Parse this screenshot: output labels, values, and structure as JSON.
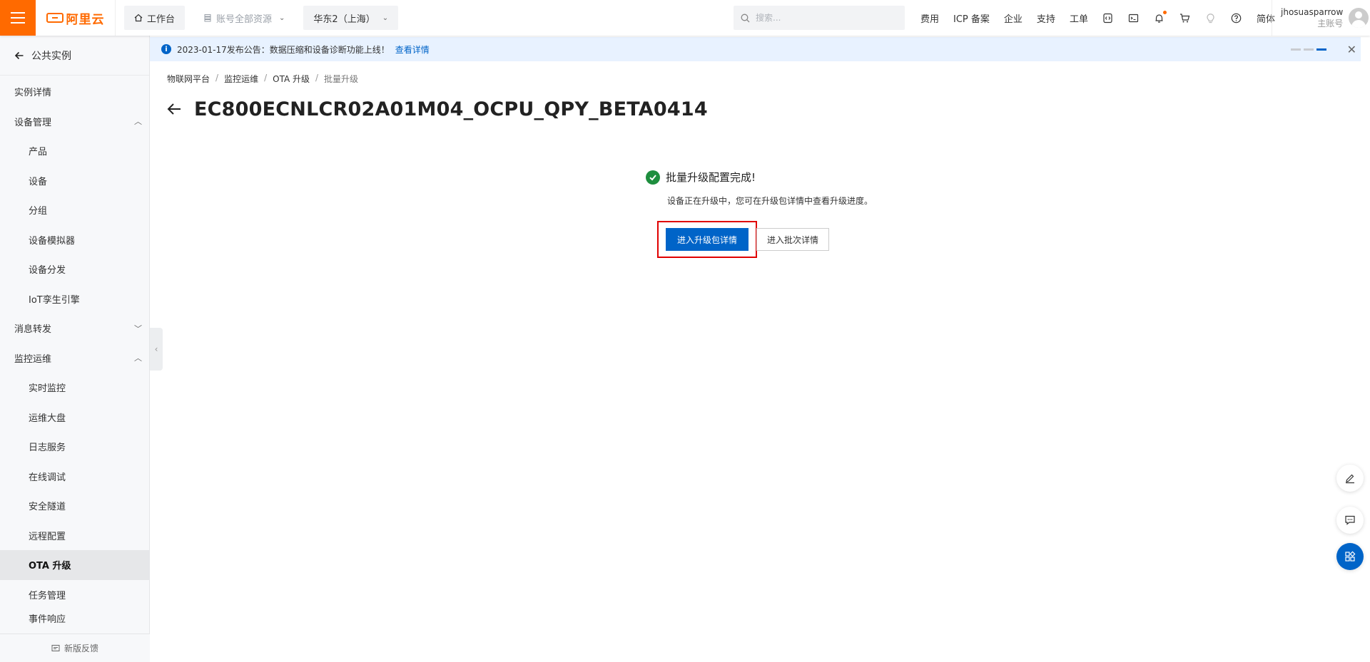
{
  "topbar": {
    "logo_text": "阿里云",
    "workbench_label": "工作台",
    "resource_label": "账号全部资源",
    "region_label": "华东2（上海）",
    "search_placeholder": "搜索...",
    "links": [
      "费用",
      "ICP 备案",
      "企业",
      "支持",
      "工单"
    ],
    "lang_label": "简体",
    "user_name": "jhosuasparrow",
    "user_role": "主账号",
    "brand_color": "#ff6a00"
  },
  "sidebar": {
    "back_label": "公共实例",
    "items": [
      {
        "label": "实例详情"
      },
      {
        "label": "设备管理"
      },
      {
        "label": "产品"
      },
      {
        "label": "设备"
      },
      {
        "label": "分组"
      },
      {
        "label": "设备模拟器"
      },
      {
        "label": "设备分发"
      },
      {
        "label": "IoT孪生引擎"
      },
      {
        "label": "消息转发"
      },
      {
        "label": "监控运维"
      },
      {
        "label": "实时监控"
      },
      {
        "label": "运维大盘"
      },
      {
        "label": "日志服务"
      },
      {
        "label": "在线调试"
      },
      {
        "label": "安全隧道"
      },
      {
        "label": "远程配置"
      },
      {
        "label": "OTA 升级"
      },
      {
        "label": "任务管理"
      },
      {
        "label": "事件响应"
      }
    ],
    "footer_label": "新版反馈"
  },
  "announcement": {
    "text": "2023-01-17发布公告：数据压缩和设备诊断功能上线！",
    "link": "查看详情"
  },
  "breadcrumb": [
    "物联网平台",
    "监控运维",
    "OTA 升级",
    "批量升级"
  ],
  "page": {
    "title": "EC800ECNLCR02A01M04_OCPU_QPY_BETA0414"
  },
  "result": {
    "title": "批量升级配置完成!",
    "description": "设备正在升级中，您可在升级包详情中查看升级进度。",
    "primary_button": "进入升级包详情",
    "secondary_button": "进入批次详情",
    "accent_color": "#0064c8",
    "success_color": "#1e8e3e",
    "highlight_color": "#e00000"
  }
}
